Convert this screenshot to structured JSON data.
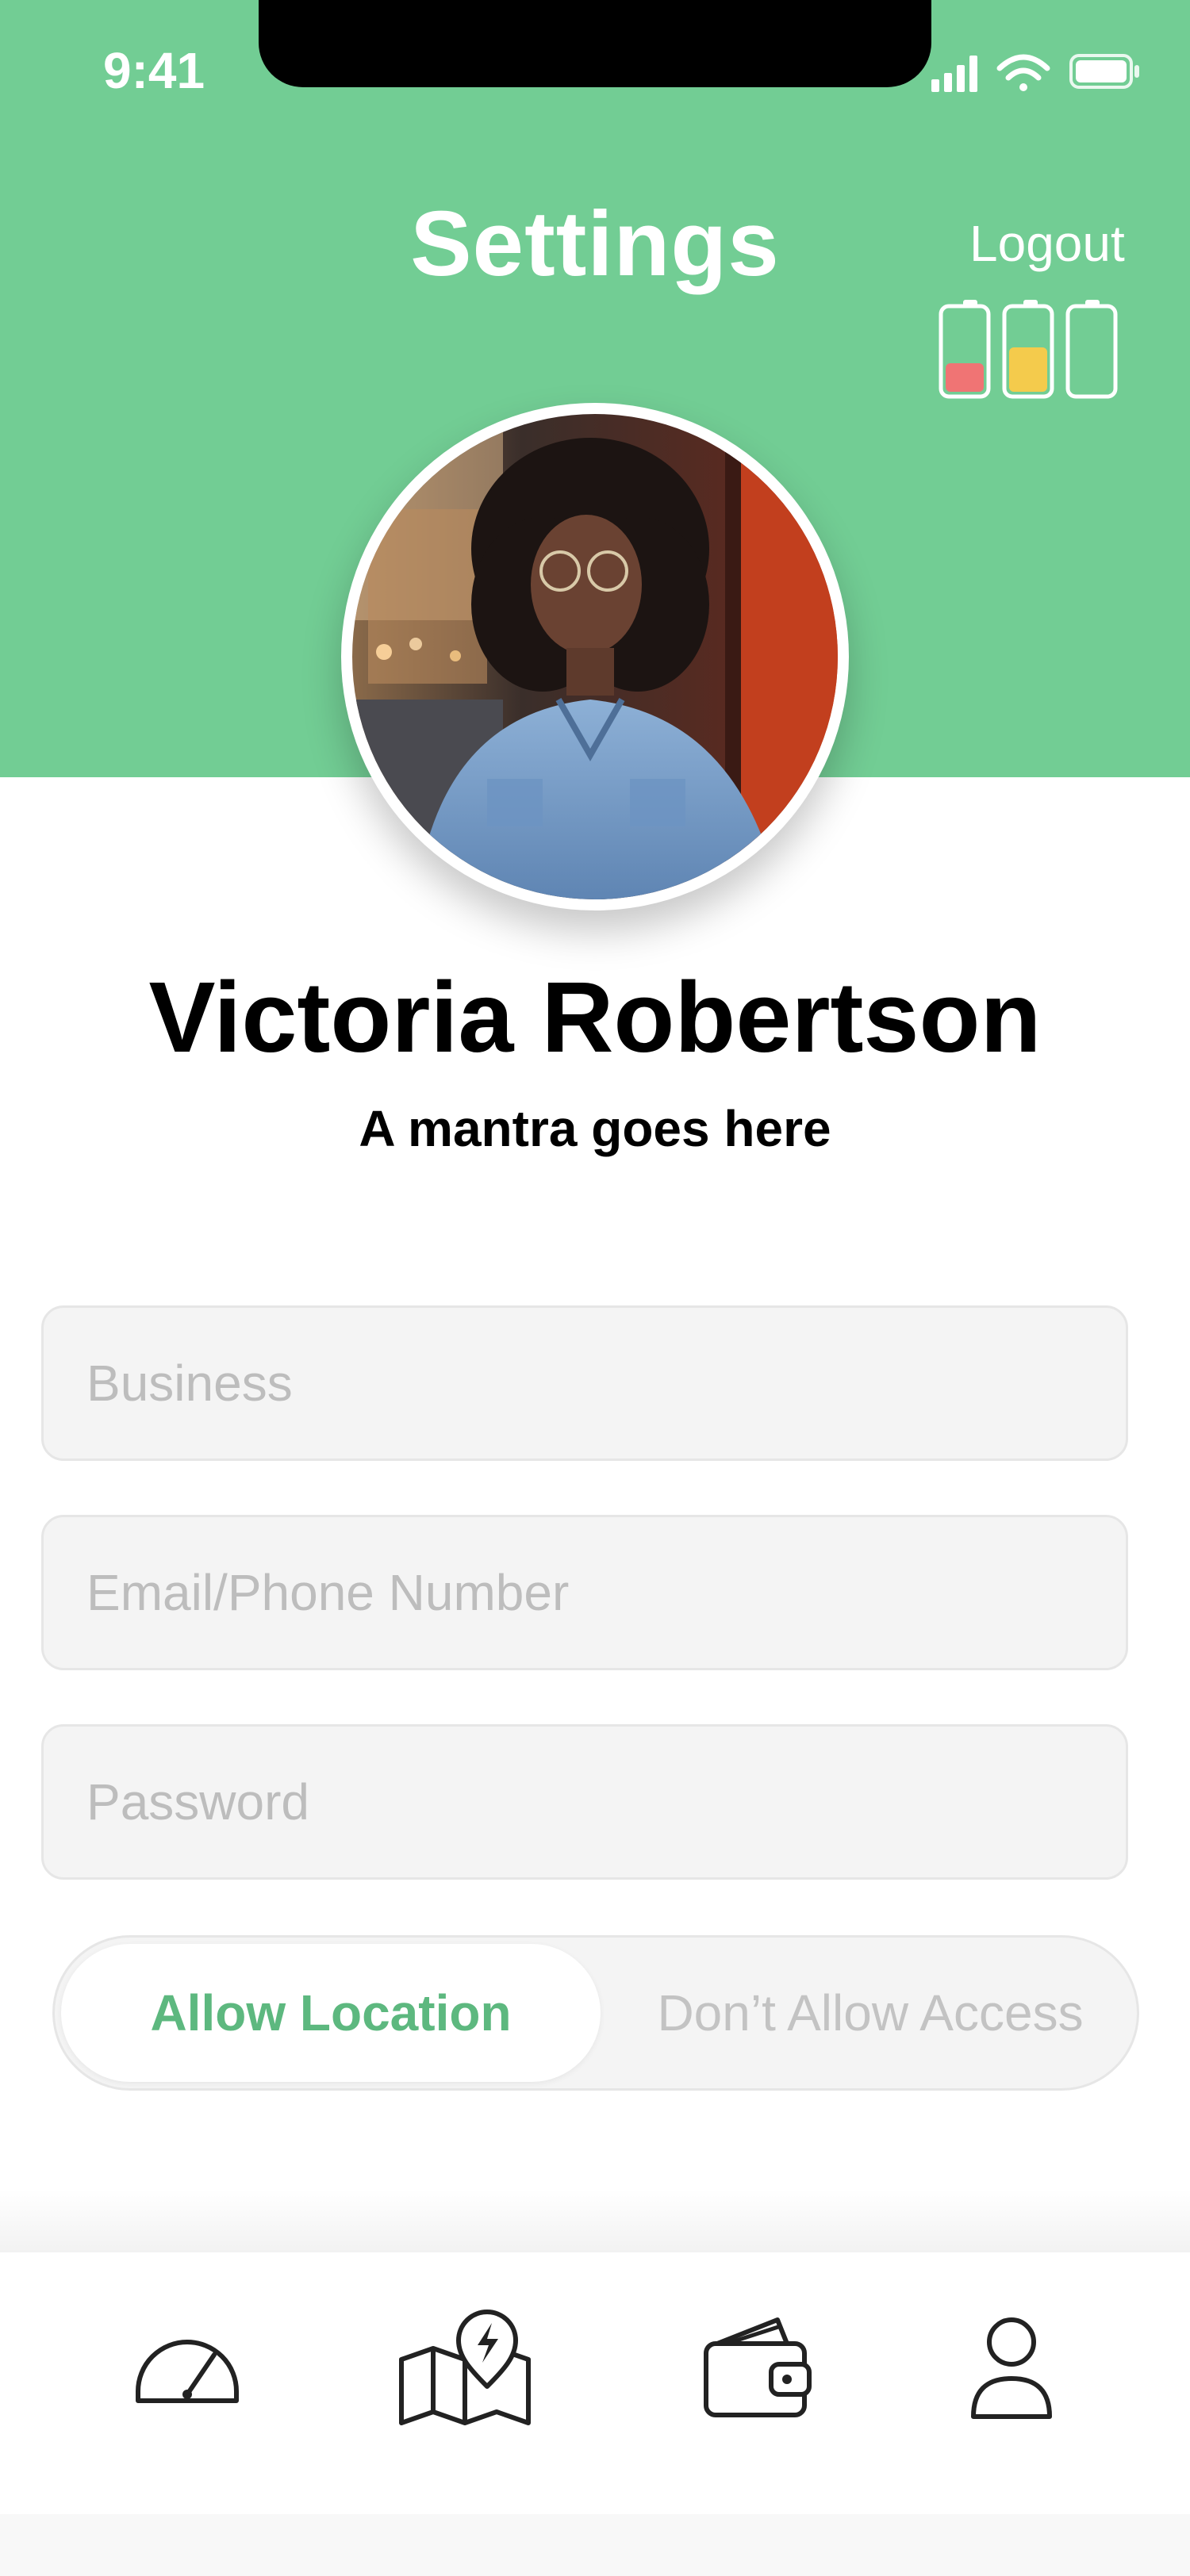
{
  "status_bar": {
    "time": "9:41"
  },
  "header": {
    "title": "Settings",
    "logout_label": "Logout",
    "background_color": "#72CD94",
    "batteries": [
      {
        "icon": "battery-low-icon",
        "level": 0.35,
        "color": "#F07474"
      },
      {
        "icon": "battery-medium-icon",
        "level": 0.55,
        "color": "#F4CB4C"
      },
      {
        "icon": "battery-empty-icon",
        "level": 0.0,
        "color": "#ffffff"
      }
    ]
  },
  "profile": {
    "avatar": "profile-photo",
    "name": "Victoria Robertson",
    "mantra": "A mantra goes here"
  },
  "form": {
    "business_placeholder": "Business",
    "contact_placeholder": "Email/Phone Number",
    "password_placeholder": "Password"
  },
  "location_toggle": {
    "allow_label": "Allow Location",
    "deny_label": "Don’t Allow Access",
    "selected": "allow",
    "accent_color": "#5DB87F"
  },
  "tab_bar": {
    "items": [
      {
        "icon": "speedometer-icon"
      },
      {
        "icon": "map-lightning-icon"
      },
      {
        "icon": "wallet-icon"
      },
      {
        "icon": "user-icon"
      }
    ]
  }
}
